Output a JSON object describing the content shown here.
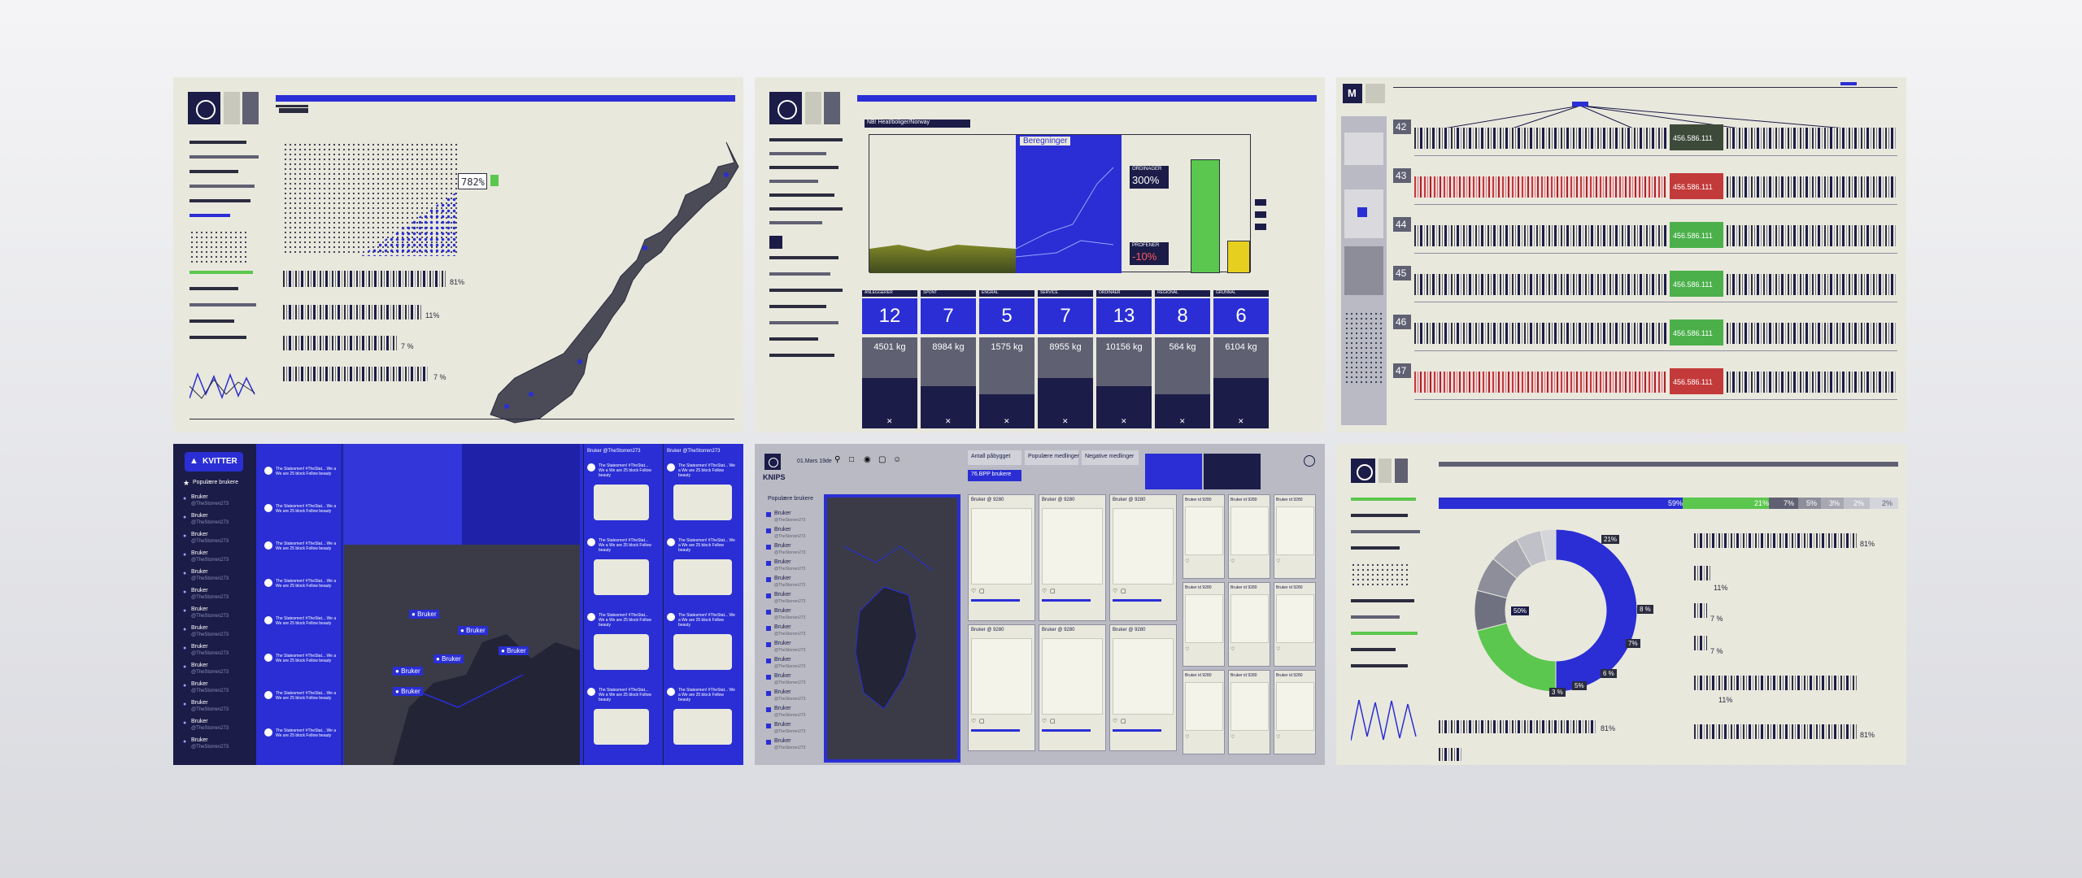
{
  "panel_norway": {
    "percent_labels": [
      "782%",
      "81%",
      "11%",
      "7 %",
      "7 %"
    ]
  },
  "panel_chart": {
    "section_title": "NB! Heat/boliger/Norway",
    "highlight_label": "Beregninger",
    "callout_top_label": "ORDINAGER",
    "callout_top_value": "300%",
    "callout_bottom_label": "PROFENER",
    "callout_bottom_value": "-10%",
    "columns": [
      {
        "header": "ANLEGGERER",
        "count": "12",
        "weight": "4501 kg"
      },
      {
        "header": "SPONT",
        "count": "7",
        "weight": "8984 kg"
      },
      {
        "header": "ENGRAL",
        "count": "5",
        "weight": "1575 kg"
      },
      {
        "header": "SERVICE",
        "count": "7",
        "weight": "8955 kg"
      },
      {
        "header": "ORDINAER",
        "count": "13",
        "weight": "10156 kg"
      },
      {
        "header": "REGIONAL",
        "count": "8",
        "weight": "564 kg"
      },
      {
        "header": "GRUNNAL",
        "count": "6",
        "weight": "6104 kg"
      }
    ]
  },
  "panel_rows": {
    "row_numbers": [
      "42",
      "43",
      "44",
      "45",
      "46",
      "47"
    ],
    "row_value": "456.586.111",
    "row_status": [
      "green",
      "red",
      "green",
      "green",
      "green",
      "red"
    ]
  },
  "panel_kvitter": {
    "app_name": "KVITTER",
    "sidebar_heading": "Populære brukere",
    "user_name": "Bruker",
    "user_handle": "@TheStorren273",
    "column_header": "Bruker @TheStorren273",
    "tweet_text": "The Statesmen! #TheStat... We a We are 25 block Follow beauty"
  },
  "panel_knips": {
    "app_name": "KNIPS",
    "date": "01.Mars 19de",
    "tabs": [
      "Antall påbygget",
      "Populære medlinger",
      "Negative medlinger"
    ],
    "sidebar_heading": "Populære brukere",
    "active_button": "76.BPP brukere",
    "user_name": "Bruker",
    "user_handle": "@TheStorren273",
    "card_title": "Bruker @ 9280",
    "card_author": "Bruker id 9280"
  },
  "panel_donut": {
    "top_bar_percents": [
      "59%",
      "21%",
      "7%",
      "5%",
      "3%",
      "2%",
      "2%"
    ],
    "center_label": "50%",
    "slice_labels": [
      "21%",
      "8 %",
      "7%",
      "6 %",
      "5%",
      "3 %"
    ],
    "bar_percents": [
      "81%",
      "11%",
      "7 %",
      "7 %",
      "81%",
      "11%",
      "81%"
    ],
    "chart_data": {
      "type": "pie",
      "values": [
        50,
        21,
        8,
        7,
        6,
        5,
        3
      ],
      "colors": [
        "#2a2ed4",
        "#5bc74e",
        "#6f7080",
        "#8d8e9a",
        "#a7a8b2",
        "#bfc0c8",
        "#d4d5db"
      ]
    }
  }
}
